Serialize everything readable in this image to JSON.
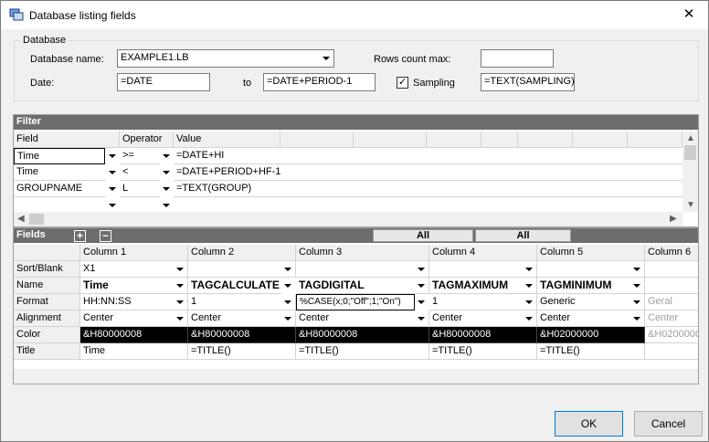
{
  "window": {
    "title": "Database listing fields",
    "close_glyph": "✕"
  },
  "database": {
    "legend": "Database",
    "name_label": "Database name:",
    "name_value": "EXAMPLE1.LB",
    "rows_label": "Rows count max:",
    "rows_value": "",
    "date_label": "Date:",
    "date_value": "=DATE",
    "to_label": "to",
    "to_value": "=DATE+PERIOD-1",
    "sampling_label": "Sampling",
    "sampling_checked": "✓",
    "sampling_value": "=TEXT(SAMPLING)"
  },
  "filter": {
    "header": "Filter",
    "columns": [
      "Field",
      "Operator",
      "Value"
    ],
    "rows": [
      {
        "field": "Time",
        "op": ">=",
        "value": "=DATE+HI"
      },
      {
        "field": "Time",
        "op": "<",
        "value": "=DATE+PERIOD+HF-1"
      },
      {
        "field": "GROUPNAME",
        "op": "L",
        "value": "=TEXT(GROUP)"
      },
      {
        "field": "",
        "op": "",
        "value": ""
      }
    ]
  },
  "fields": {
    "header": "Fields",
    "add": "+",
    "remove": "−",
    "all1": "All",
    "all2": "All",
    "columns": [
      "Column 1",
      "Column 2",
      "Column 3",
      "Column 4",
      "Column 5",
      "Column 6"
    ],
    "row_labels": [
      "Sort/Blank",
      "Name",
      "Format",
      "Alignment",
      "Color",
      "Title"
    ],
    "sort": [
      "X1",
      "",
      "",
      "",
      "",
      ""
    ],
    "name": [
      "Time",
      "TAGCALCULATE",
      "TAGDIGITAL",
      "TAGMAXIMUM",
      "TAGMINIMUM",
      ""
    ],
    "format": [
      "HH:NN:SS",
      "1",
      "%CASE(x;0;\"Off\";1;\"On\")",
      "1",
      "Generic",
      "Geral"
    ],
    "alignment": [
      "Center",
      "Center",
      "Center",
      "Center",
      "Center",
      "Center"
    ],
    "color": [
      "&H80000008",
      "&H80000008",
      "&H80000008",
      "&H80000008",
      "&H02000000",
      "&H0200000"
    ],
    "title": [
      "Time",
      "=TITLE()",
      "=TITLE()",
      "=TITLE()",
      "=TITLE()",
      ""
    ]
  },
  "buttons": {
    "ok": "OK",
    "cancel": "Cancel"
  }
}
